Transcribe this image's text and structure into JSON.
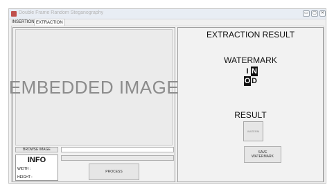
{
  "window": {
    "title": "Double Frame Random Steganography"
  },
  "tabs": [
    {
      "label": "INSERTION"
    },
    {
      "label": "EXTRACTION"
    }
  ],
  "left": {
    "embedded_image_text": "EMBEDDED IMAGE",
    "browse_button": "BROWSE IMAGE",
    "info": {
      "title": "INFO",
      "width_label": "WIDTH :",
      "height_label": "HEIGHT :"
    },
    "process_button": "PROCESS"
  },
  "right": {
    "title": "EXTRACTION RESULT",
    "watermark_label": "WATERMARK",
    "logo_letters": [
      "I",
      "N",
      "O",
      "D"
    ],
    "result_label": "RESULT",
    "result_preview_text": "WATERM",
    "save_button": "SAVE WATERMARK"
  },
  "colors": {
    "logo": "#111111",
    "title_text": "#111111"
  }
}
